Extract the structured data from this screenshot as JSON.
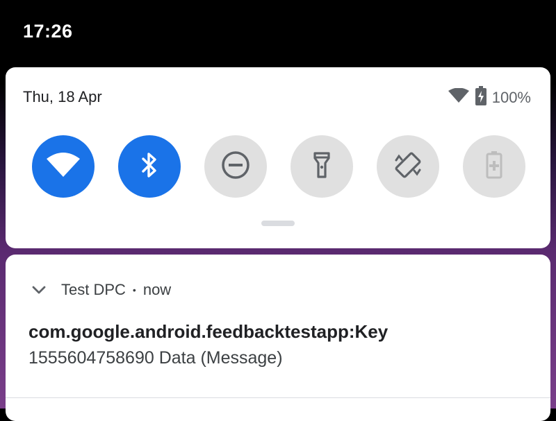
{
  "status_bar": {
    "time": "17:26"
  },
  "quick_settings": {
    "date": "Thu, 18 Apr",
    "battery_percent": "100%",
    "tiles": [
      {
        "icon": "wifi-icon",
        "state": "on"
      },
      {
        "icon": "bluetooth-icon",
        "state": "on"
      },
      {
        "icon": "do-not-disturb-icon",
        "state": "off"
      },
      {
        "icon": "flashlight-icon",
        "state": "off"
      },
      {
        "icon": "auto-rotate-icon",
        "state": "off"
      },
      {
        "icon": "battery-saver-icon",
        "state": "disabled"
      }
    ]
  },
  "notification": {
    "app_name": "Test DPC",
    "separator": "•",
    "time": "now",
    "title": "com.google.android.feedbacktestapp:Key",
    "body": "1555604758690 Data (Message)"
  },
  "colors": {
    "accent": "#1a73e8",
    "tile_off": "#e0e0e0",
    "icon_gray": "#5f6368"
  }
}
